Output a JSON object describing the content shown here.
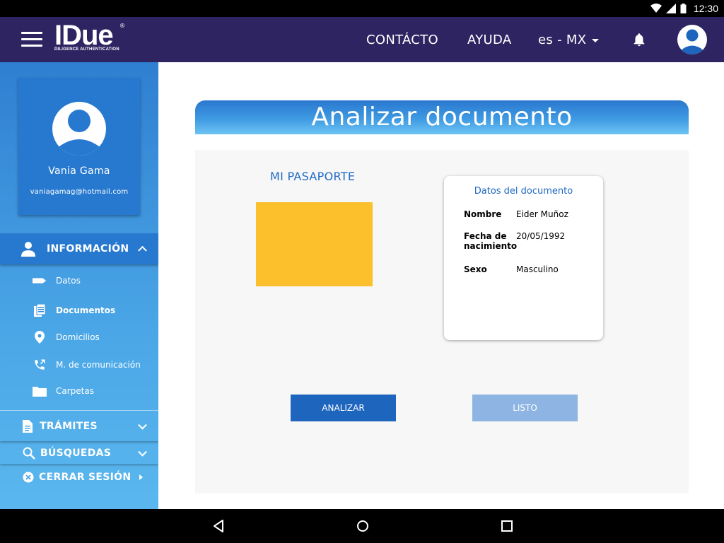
{
  "status_bar": {
    "time": "12:30"
  },
  "header": {
    "logo": {
      "mark": "IDue",
      "reg": "®",
      "tagline": "DILIGENCE AUTHENTICATION"
    },
    "nav": {
      "contact": "CONTÁCTO",
      "help": "AYUDA",
      "language": "es - MX"
    }
  },
  "sidebar": {
    "user": {
      "name": "Vania Gama",
      "email": "vaniagamag@hotmail.com"
    },
    "info_section": {
      "label": "INFORMACIÓN",
      "items": [
        {
          "label": "Datos",
          "icon": "tag-icon"
        },
        {
          "label": "Documentos",
          "icon": "documents-icon",
          "active": true
        },
        {
          "label": "Domicilios",
          "icon": "location-pin-icon"
        },
        {
          "label": "M. de comunicación",
          "icon": "phone-icon"
        },
        {
          "label": "Carpetas",
          "icon": "folder-icon"
        }
      ]
    },
    "tramites": {
      "label": "TRÁMITES"
    },
    "busquedas": {
      "label": "BÚSQUEDAS"
    },
    "logout": {
      "label": "CERRAR SESIÓN"
    }
  },
  "main": {
    "title": "Analizar documento",
    "document_type": "MI PASAPORTE",
    "data_card": {
      "title": "Datos del documento",
      "fields": [
        {
          "label": "Nombre",
          "value": "Eider Muñoz"
        },
        {
          "label": "Fecha de nacimiento",
          "value": "20/05/1992"
        },
        {
          "label": "Sexo",
          "value": "Masculino"
        }
      ]
    },
    "buttons": {
      "analyze": "ANALIZAR",
      "done": "LISTO"
    }
  },
  "colors": {
    "header_bg": "#2f2462",
    "sidebar_blue": "#2779cf",
    "accent_blue": "#1d65bd",
    "disabled_blue": "#8db4e2",
    "doc_placeholder": "#fcc02d"
  }
}
